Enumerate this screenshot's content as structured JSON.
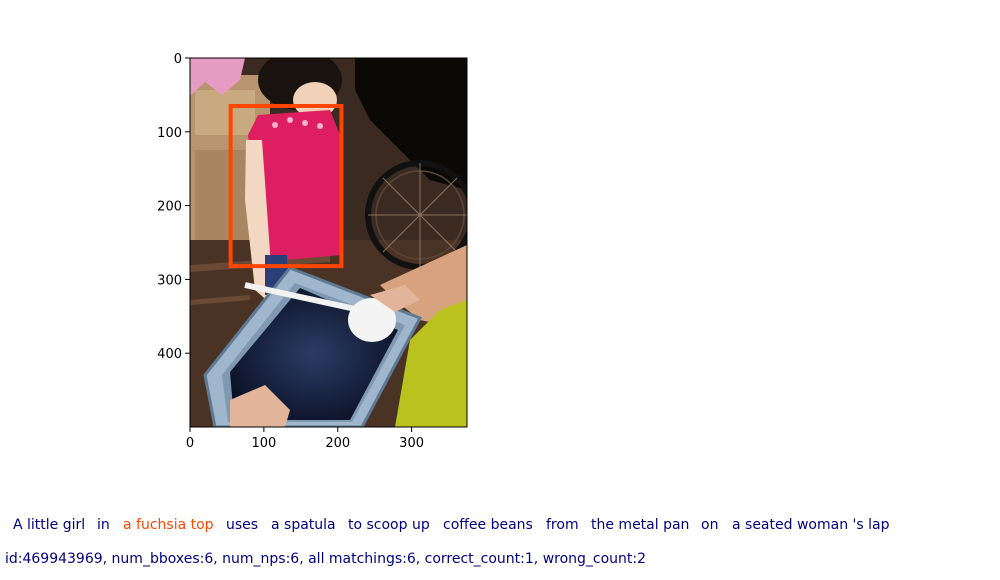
{
  "figure": {
    "x_ticks": [
      "0",
      "100",
      "200",
      "300"
    ],
    "y_ticks": [
      "0",
      "100",
      "200",
      "300",
      "400"
    ],
    "x_tick_values": [
      0,
      100,
      200,
      300
    ],
    "y_tick_values": [
      0,
      100,
      200,
      300,
      400
    ],
    "image_extent": {
      "width": 375,
      "height": 500
    },
    "highlight_box": {
      "x_min": 55,
      "y_min": 65,
      "x_max": 205,
      "y_max": 282
    },
    "highlight_color": "#ff4500"
  },
  "caption": {
    "phrases": [
      {
        "text": "A little girl",
        "color": "#00007f"
      },
      {
        "text": "in",
        "color": "#00007f"
      },
      {
        "text": "a fuchsia top",
        "color": "#ff4500"
      },
      {
        "text": "uses",
        "color": "#00007f"
      },
      {
        "text": "a spatula",
        "color": "#00007f"
      },
      {
        "text": "to scoop up",
        "color": "#00007f"
      },
      {
        "text": "coffee beans",
        "color": "#00007f"
      },
      {
        "text": "from",
        "color": "#00007f"
      },
      {
        "text": "the metal pan",
        "color": "#00007f"
      },
      {
        "text": "on",
        "color": "#00007f"
      },
      {
        "text": "a seated woman 's lap",
        "color": "#00007f"
      }
    ]
  },
  "info_line": "id:469943969, num_bboxes:6, num_nps:6, all matchings:6, correct_count:1, wrong_count:2",
  "colors": {
    "text": "#00007f",
    "highlight": "#ff4500"
  }
}
